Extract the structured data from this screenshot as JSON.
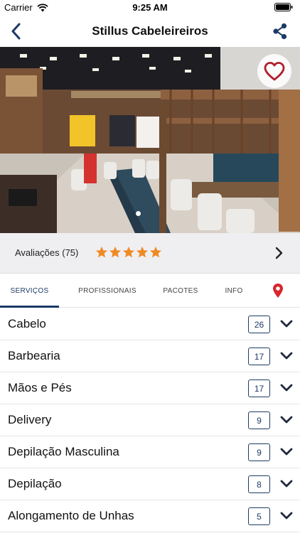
{
  "status_bar": {
    "carrier": "Carrier",
    "time": "9:25 AM"
  },
  "nav": {
    "title": "Stillus Cabeleireiros"
  },
  "hero": {
    "image_alt": "Salon interior photo"
  },
  "ratings": {
    "label": "Avaliações (75)",
    "stars": 5
  },
  "tabs": [
    {
      "label": "SERVIÇOS"
    },
    {
      "label": "PROFISSIONAIS"
    },
    {
      "label": "PACOTES"
    },
    {
      "label": "INFO"
    }
  ],
  "categories": [
    {
      "name": "Cabelo",
      "count": "26"
    },
    {
      "name": "Barbearia",
      "count": "17"
    },
    {
      "name": "Mãos e Pés",
      "count": "17"
    },
    {
      "name": "Delivery",
      "count": "9"
    },
    {
      "name": "Depilação Masculina",
      "count": "9"
    },
    {
      "name": "Depilação",
      "count": "8"
    },
    {
      "name": "Alongamento de Unhas",
      "count": "5"
    }
  ],
  "colors": {
    "accent": "#1b3a66",
    "star": "#f08a24",
    "location_pin": "#d9262c",
    "favorite": "#b01f2e"
  }
}
